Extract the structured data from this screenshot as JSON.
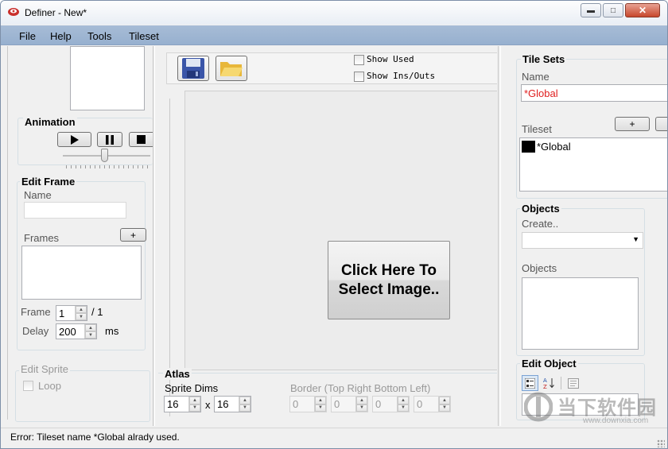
{
  "window": {
    "title": "Definer - New*"
  },
  "menu": [
    "File",
    "Help",
    "Tools",
    "Tileset"
  ],
  "animation": {
    "title": "Animation"
  },
  "edit_frame": {
    "title": "Edit Frame",
    "name_label": "Name",
    "frames_label": "Frames",
    "add_label": "+",
    "frame_label": "Frame",
    "frame_value": "1",
    "frame_total": "/ 1",
    "delay_label": "Delay",
    "delay_value": "200",
    "delay_unit": "ms"
  },
  "edit_sprite": {
    "title": "Edit Sprite",
    "loop_label": "Loop"
  },
  "toolbar": {
    "show_used_label": "Show Used",
    "show_ins_outs_label": "Show Ins/Outs"
  },
  "canvas": {
    "select_image_label": "Click Here To Select Image.."
  },
  "atlas": {
    "title": "Atlas",
    "sprite_dims_label": "Sprite Dims",
    "width_value": "16",
    "times": "x",
    "height_value": "16",
    "border_label": "Border (Top Right Bottom Left)",
    "border_values": [
      "0",
      "0",
      "0",
      "0"
    ]
  },
  "tile_sets": {
    "title": "Tile Sets",
    "name_label": "Name",
    "name_value": "*Global",
    "add_label": "+",
    "tileset_label": "Tileset",
    "tileset_items": [
      "*Global"
    ]
  },
  "objects": {
    "title": "Objects",
    "create_label": "Create..",
    "objects_label": "Objects"
  },
  "edit_object": {
    "title": "Edit Object"
  },
  "status": {
    "message": "Error: Tileset name *Global alrady used."
  },
  "watermark": {
    "name": "当下软件园",
    "url": "www.downxia.com"
  },
  "colors": {
    "menubar": "#a0b7d3",
    "error_text": "#e02020",
    "accent_border": "#7d8fa8"
  }
}
